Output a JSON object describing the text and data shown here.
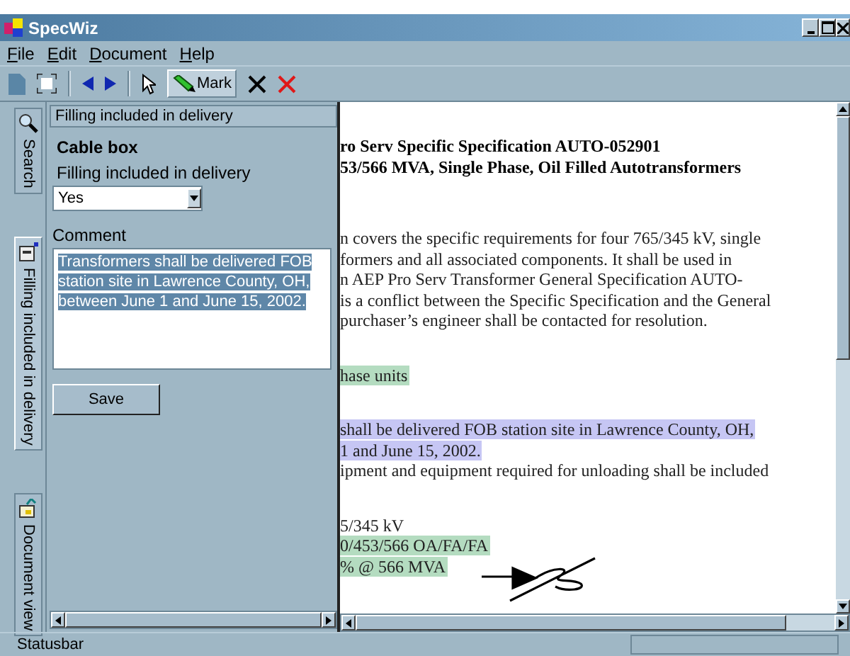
{
  "window": {
    "title": "SpecWiz"
  },
  "menu": [
    {
      "label": "File"
    },
    {
      "label": "Edit"
    },
    {
      "label": "Document"
    },
    {
      "label": "Help"
    }
  ],
  "toolbar": [
    {
      "kind": "page"
    },
    {
      "kind": "fit"
    },
    {
      "kind": "separator"
    },
    {
      "kind": "back"
    },
    {
      "kind": "forward"
    },
    {
      "kind": "separator"
    },
    {
      "kind": "pointer"
    },
    {
      "kind": "mark",
      "label": "Mark",
      "selected": true
    },
    {
      "kind": "delete"
    },
    {
      "kind": "delete-red"
    }
  ],
  "side_tabs": [
    {
      "label": "Search",
      "kind": "search",
      "selected": false
    },
    {
      "label": "Filling included in delivery",
      "kind": "form",
      "selected": true
    },
    {
      "label": "Document view",
      "kind": "document",
      "selected": false
    }
  ],
  "panel": {
    "header": "Filling included in delivery",
    "title": "Cable box",
    "field_label": "Filling included in delivery",
    "dropdown": {
      "value": "Yes"
    },
    "comment_label": "Comment",
    "comment": "Transformers shall be delivered FOB station site in Lawrence County, OH, between June 1 and June 15, 2002.",
    "save": "Save"
  },
  "document": {
    "paragraphs": [
      {
        "bold": true,
        "lines": [
          {
            "text": "ro Serv Specific Specification AUTO-052901"
          },
          {
            "text": "53/566 MVA, Single Phase, Oil Filled Autotransformers"
          }
        ]
      },
      {
        "bold": false,
        "lines": [
          {
            "text": "n covers the specific requirements for four 765/345 kV, single"
          },
          {
            "text": "formers and all associated components. It shall be used in"
          },
          {
            "text": "n AEP Pro Serv Transformer General Specification AUTO-"
          },
          {
            "text": "is a conflict between the Specific Specification and the General"
          },
          {
            "text": "purchaser’s engineer shall be contacted for resolution."
          }
        ]
      },
      {
        "bold": false,
        "lines": [
          {
            "text": "hase units",
            "color": "#b4dcc0"
          }
        ]
      },
      {
        "bold": false,
        "lines": [
          {
            "text": "shall be delivered FOB station site in Lawrence County, OH,",
            "color": "#c6c6f4"
          },
          {
            "text": "1 and June 15, 2002.",
            "color": "#c6c6f4"
          },
          {
            "text": "ipment and equipment required for unloading shall be included"
          }
        ]
      },
      {
        "bold": false,
        "lines": [
          {
            "text": "5/345 kV"
          },
          {
            "text": "0/453/566  OA/FA/FA",
            "color": "#b4dcc0"
          },
          {
            "text": "% @ 566 MVA",
            "color": "#b4dcc0"
          }
        ]
      }
    ]
  },
  "status_bar": {
    "text": "Statusbar"
  }
}
